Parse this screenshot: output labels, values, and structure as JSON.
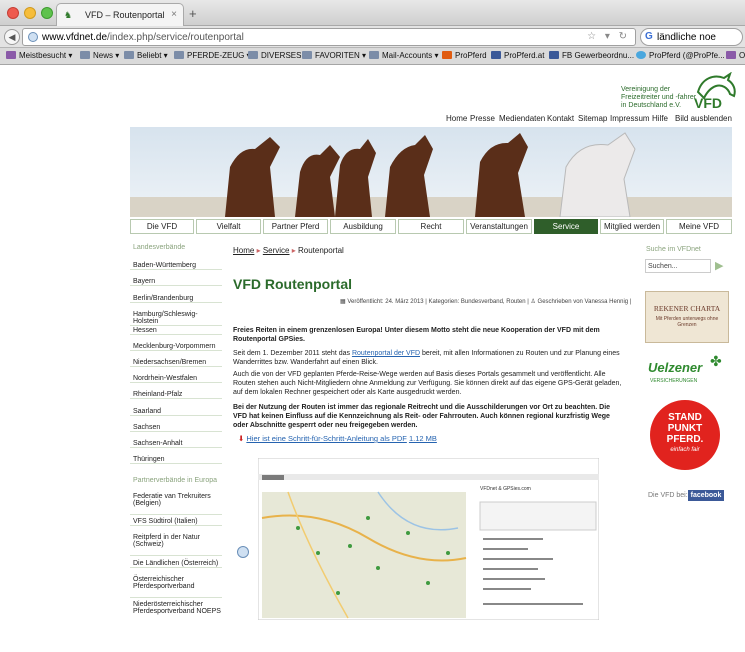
{
  "browser": {
    "tab_title": "VFD – Routenportal",
    "url_host": "www.vfdnet.de",
    "url_path": "/index.php/service/routenportal",
    "search_value": "ländliche noe"
  },
  "bookmarks": [
    {
      "label": "Meistbesucht ▾",
      "icon": "folder"
    },
    {
      "label": "News ▾",
      "icon": "folder"
    },
    {
      "label": "Beliebt ▾",
      "icon": "folder"
    },
    {
      "label": "PFERDE-ZEUG ▾",
      "icon": "folder"
    },
    {
      "label": "DIVERSES ▾",
      "icon": "folder"
    },
    {
      "label": "FAVORITEN ▾",
      "icon": "folder"
    },
    {
      "label": "Mail-Accounts ▾",
      "icon": "folder"
    },
    {
      "label": "ProPferd",
      "icon": "pf"
    },
    {
      "label": "ProPferd.at",
      "icon": "fb"
    },
    {
      "label": "FB Gewerbeordnu...",
      "icon": "fb"
    },
    {
      "label": "ProPferd (@ProPfe...",
      "icon": "tw"
    },
    {
      "label": "Of",
      "icon": "mb"
    }
  ],
  "site": {
    "logo_text": "Vereinigung der Freizeitreiter und -fahrer in Deutschland e.V.",
    "logo_mark": "VFD",
    "top_nav": [
      "Home",
      "Presse",
      "Mediendaten",
      "Kontakt",
      "Sitemap",
      "Impressum",
      "Hilfe",
      "Bild ausblenden"
    ],
    "main_nav": [
      "Die VFD",
      "Vielfalt",
      "Partner Pferd",
      "Ausbildung",
      "Recht",
      "Veranstaltungen",
      "Service",
      "Mitglied werden",
      "Meine VFD"
    ],
    "active_nav": "Service"
  },
  "sidebar": {
    "heading1": "Landesverbände",
    "states": [
      "Baden-Württemberg",
      "Bayern",
      "Berlin/Brandenburg",
      "Hamburg/Schleswig-Holstein",
      "Hessen",
      "Mecklenburg-Vorpommern",
      "Niedersachsen/Bremen",
      "Nordrhein-Westfalen",
      "Rheinland-Pfalz",
      "Saarland",
      "Sachsen",
      "Sachsen-Anhalt",
      "Thüringen"
    ],
    "heading2": "Partnerverbände in Europa",
    "partners": [
      "Federatie van Trekruiters (Belgien)",
      "VFS Südtirol (Italien)",
      "Reitpferd in der Natur (Schweiz)",
      "Die Ländlichen (Österreich)",
      "Österreichischer Pferdesportverband",
      "Niederösterreichischer Pferdesportverband NOEPS"
    ]
  },
  "breadcrumb": [
    "Home",
    "Service",
    "Routenportal"
  ],
  "article": {
    "title": "VFD Routenportal",
    "meta_date": "Veröffentlicht: 24. März 2013 | ",
    "meta_cat": "Kategorien: Bundesverband, Routen | ",
    "meta_author": "Geschrieben von Vanessa Hennig |",
    "intro": "Freies Reiten in einem grenzenlosen Europa! Unter diesem Motto steht die neue Kooperation der VFD mit dem Routenportal GPSies.",
    "p1_before": "Seit dem 1. Dezember 2011 steht das ",
    "p1_link": "Routenportal der VFD",
    "p1_after": " bereit, mit allen Informationen zu Routen und zur Planung eines Wanderrittes bzw. Wanderfahrt auf einen Blick.",
    "p2": "Auch die von der VFD geplanten Pferde-Reise-Wege werden auf Basis dieses Portals gesammelt und veröffentlicht. Alle Routen stehen auch Nicht-Mitgliedern ohne Anmeldung zur Verfügung. Sie können direkt auf das eigene GPS-Gerät geladen, auf dem lokalen Rechner gespeichert oder als Karte ausgedruckt werden.",
    "p3": "Bei der Nutzung der Routen ist immer das regionale Reitrecht und die Ausschilderungen vor Ort zu beachten. Die VFD hat keinen Einfluss auf die Kennzeichnung als Reit- oder Fahrrouten. Auch können regional kurzfristig Wege oder Abschnitte gesperrt oder neu freigegeben werden.",
    "pdf_link": "Hier ist eine Schritt-für-Schritt-Anleitung als PDF",
    "pdf_size": "1.12 MB",
    "screenshot_caption": "VFDnet & GPSies.com"
  },
  "right": {
    "search_heading": "Suche im VFDnet",
    "search_placeholder": "Suchen...",
    "ad1": "REKENER CHARTA",
    "ad1_sub": "Mit Pferden unterwegs ohne Grenzen",
    "ad2": "Uelzener",
    "ad2_sub": "VERSICHERUNGEN",
    "ad3_l1": "STAND",
    "ad3_l2": "PUNKT",
    "ad3_l3": "PFERD.",
    "ad3_sub": "einfach fair",
    "fb_label": "Die VFD bei:",
    "fb_brand": "facebook"
  }
}
